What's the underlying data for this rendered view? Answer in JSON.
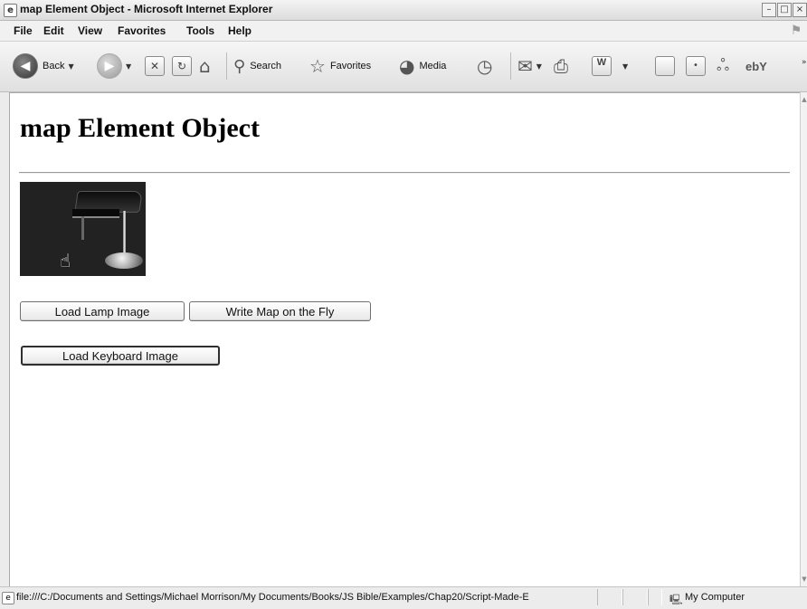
{
  "window": {
    "title": "map Element Object - Microsoft Internet Explorer",
    "app_icon": "ie-page-icon",
    "controls": [
      "minimize",
      "maximize",
      "close"
    ]
  },
  "menubar": {
    "items": [
      "File",
      "Edit",
      "View",
      "Favorites",
      "Tools",
      "Help"
    ]
  },
  "toolbar": {
    "back_label": "Back",
    "search_label": "Search",
    "favorites_label": "Favorites",
    "media_label": "Media",
    "icons": [
      "back-icon",
      "forward-icon",
      "stop-icon",
      "refresh-icon",
      "home-icon",
      "search-icon",
      "favorites-icon",
      "media-icon",
      "history-icon",
      "mail-icon",
      "print-icon",
      "word-icon",
      "blank-page-icon",
      "messenger-icon",
      "ebay-icon"
    ]
  },
  "page": {
    "heading": "map Element Object",
    "image_alt": "lamp image",
    "buttons": {
      "load_lamp": "Load Lamp Image",
      "write_map": "Write Map on the Fly",
      "load_keyboard": "Load Keyboard Image"
    }
  },
  "statusbar": {
    "url": "file:///C:/Documents and Settings/Michael Morrison/My Documents/Books/JS Bible/Examples/Chap20/Script-Made-E",
    "zone": "My Computer"
  }
}
